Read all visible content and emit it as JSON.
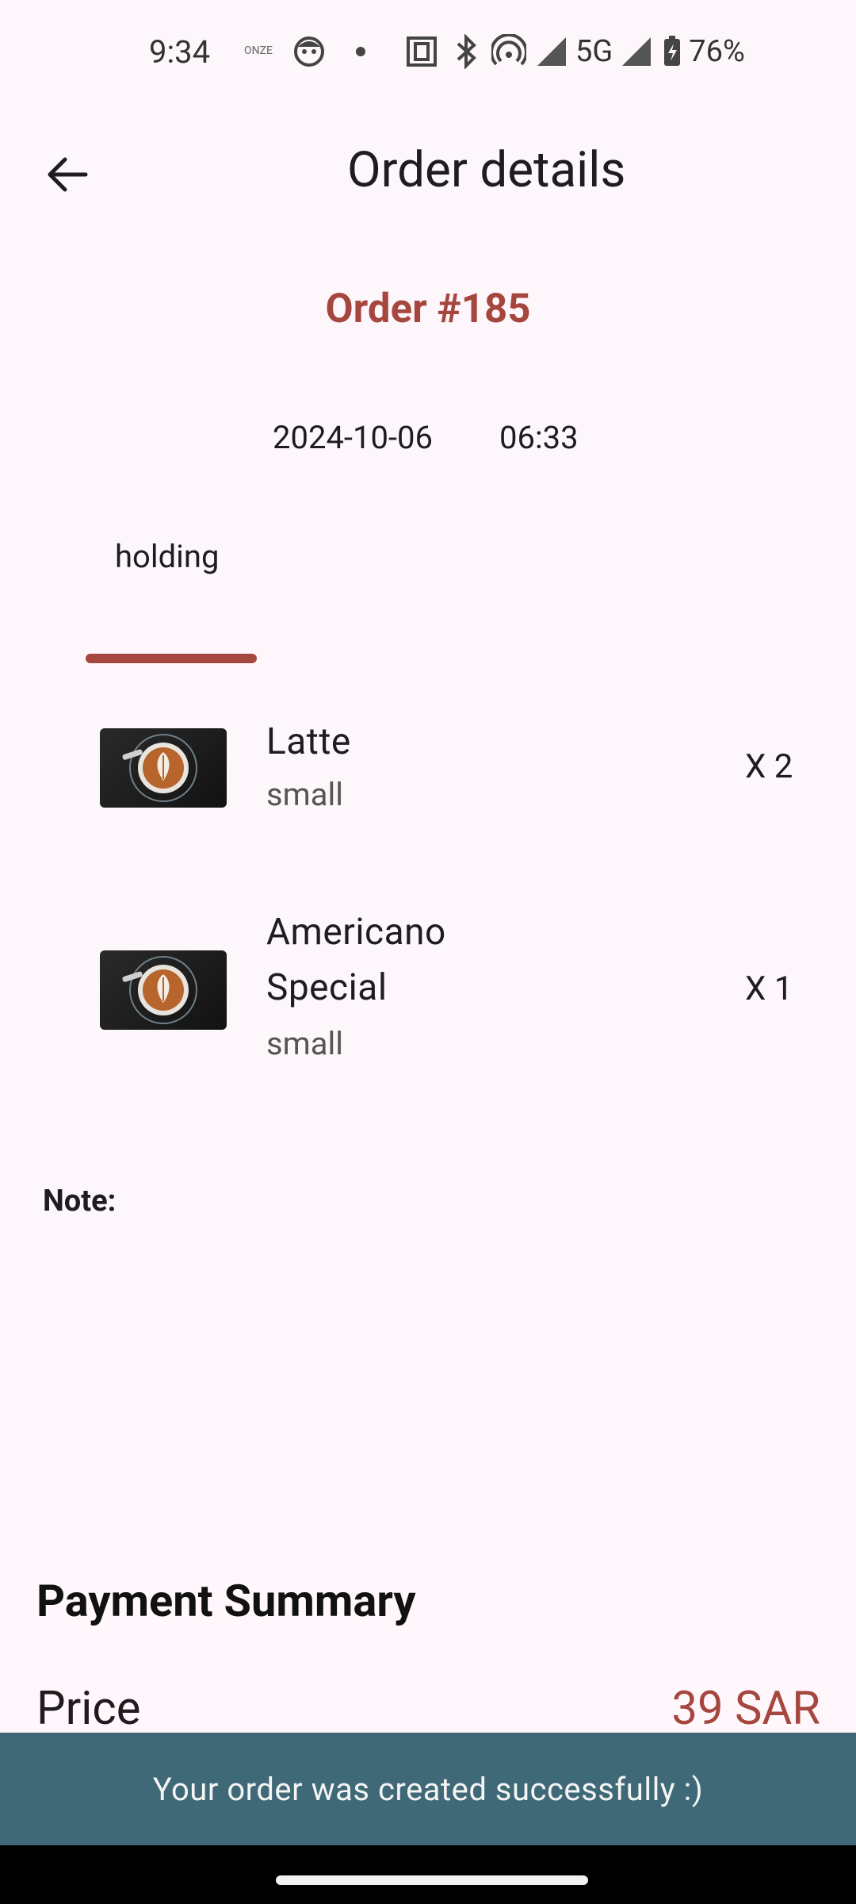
{
  "status_bar": {
    "time": "9:34",
    "brand_small": "ONZE",
    "network": "5G",
    "battery": "76%"
  },
  "header": {
    "title": "Order details",
    "back_icon": "arrow-left-icon"
  },
  "order": {
    "number": "Order #185",
    "date": "2024-10-06",
    "time": "06:33",
    "status": "holding"
  },
  "items": [
    {
      "name_line1": "Latte",
      "name_line2": "",
      "size": "small",
      "qty": "X 2"
    },
    {
      "name_line1": "Americano",
      "name_line2": "Special",
      "size": "small",
      "qty": "X 1"
    }
  ],
  "note": {
    "label": "Note:"
  },
  "payment": {
    "title": "Payment Summary",
    "price_label": "Price",
    "price_value": "39 SAR"
  },
  "snackbar": {
    "message": "Your order was created successfully :)"
  },
  "colors": {
    "accent": "#A6473F",
    "snackbar": "#3F6977",
    "background": "#FDF7FC"
  }
}
